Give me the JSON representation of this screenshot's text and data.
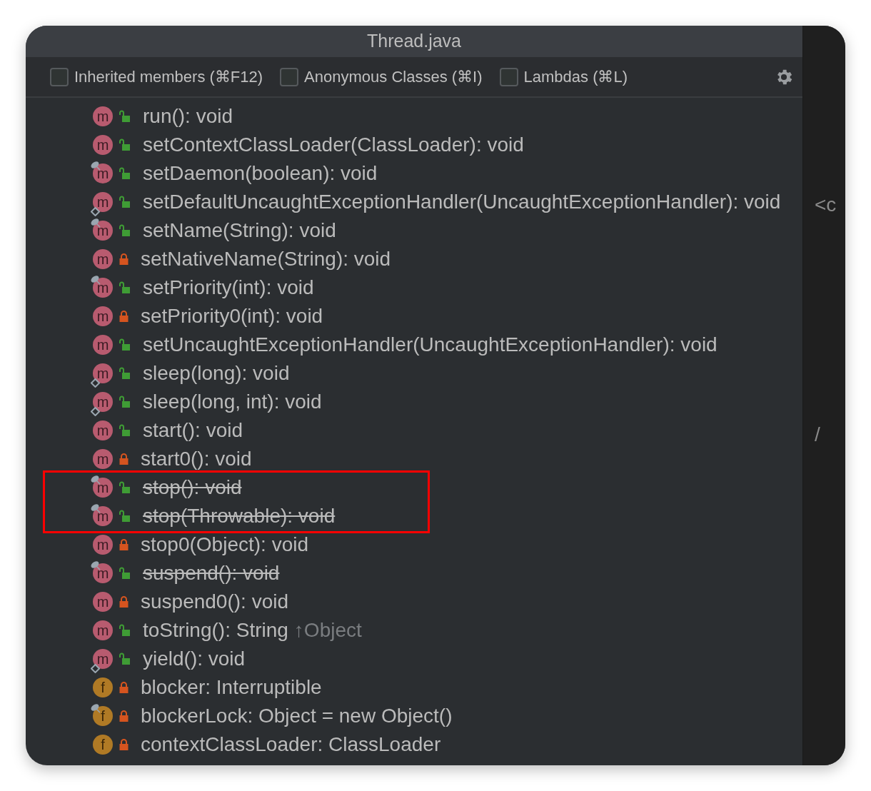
{
  "window": {
    "title": "Thread.java"
  },
  "filters": [
    {
      "label": "Inherited members (⌘F12)",
      "checked": false
    },
    {
      "label": "Anonymous Classes (⌘I)",
      "checked": false
    },
    {
      "label": "Lambdas (⌘L)",
      "checked": false
    }
  ],
  "members": [
    {
      "icon_letter": "m",
      "kind": "method",
      "locked": false,
      "pin_mark": false,
      "diamond_mark": false,
      "deprecated": false,
      "highlighted": false,
      "text": "run(): void"
    },
    {
      "icon_letter": "m",
      "kind": "method",
      "locked": false,
      "pin_mark": false,
      "diamond_mark": false,
      "deprecated": false,
      "highlighted": false,
      "text": "setContextClassLoader(ClassLoader): void"
    },
    {
      "icon_letter": "m",
      "kind": "method",
      "locked": false,
      "pin_mark": true,
      "diamond_mark": false,
      "deprecated": false,
      "highlighted": false,
      "text": "setDaemon(boolean): void"
    },
    {
      "icon_letter": "m",
      "kind": "method",
      "locked": false,
      "pin_mark": false,
      "diamond_mark": true,
      "deprecated": false,
      "highlighted": false,
      "text": "setDefaultUncaughtExceptionHandler(UncaughtExceptionHandler): void"
    },
    {
      "icon_letter": "m",
      "kind": "method",
      "locked": false,
      "pin_mark": true,
      "diamond_mark": false,
      "deprecated": false,
      "highlighted": false,
      "text": "setName(String): void"
    },
    {
      "icon_letter": "m",
      "kind": "method",
      "locked": true,
      "pin_mark": false,
      "diamond_mark": false,
      "deprecated": false,
      "highlighted": false,
      "text": "setNativeName(String): void"
    },
    {
      "icon_letter": "m",
      "kind": "method",
      "locked": false,
      "pin_mark": true,
      "diamond_mark": false,
      "deprecated": false,
      "highlighted": false,
      "text": "setPriority(int): void"
    },
    {
      "icon_letter": "m",
      "kind": "method",
      "locked": true,
      "pin_mark": false,
      "diamond_mark": false,
      "deprecated": false,
      "highlighted": false,
      "text": "setPriority0(int): void"
    },
    {
      "icon_letter": "m",
      "kind": "method",
      "locked": false,
      "pin_mark": false,
      "diamond_mark": false,
      "deprecated": false,
      "highlighted": false,
      "text": "setUncaughtExceptionHandler(UncaughtExceptionHandler): void"
    },
    {
      "icon_letter": "m",
      "kind": "method",
      "locked": false,
      "pin_mark": false,
      "diamond_mark": true,
      "deprecated": false,
      "highlighted": false,
      "text": "sleep(long): void"
    },
    {
      "icon_letter": "m",
      "kind": "method",
      "locked": false,
      "pin_mark": false,
      "diamond_mark": true,
      "deprecated": false,
      "highlighted": false,
      "text": "sleep(long, int): void"
    },
    {
      "icon_letter": "m",
      "kind": "method",
      "locked": false,
      "pin_mark": false,
      "diamond_mark": false,
      "deprecated": false,
      "highlighted": false,
      "text": "start(): void"
    },
    {
      "icon_letter": "m",
      "kind": "method",
      "locked": true,
      "pin_mark": false,
      "diamond_mark": false,
      "deprecated": false,
      "highlighted": false,
      "text": "start0(): void"
    },
    {
      "icon_letter": "m",
      "kind": "method",
      "locked": false,
      "pin_mark": true,
      "diamond_mark": false,
      "deprecated": true,
      "highlighted": true,
      "text": "stop(): void"
    },
    {
      "icon_letter": "m",
      "kind": "method",
      "locked": false,
      "pin_mark": true,
      "diamond_mark": false,
      "deprecated": true,
      "highlighted": true,
      "text": "stop(Throwable): void"
    },
    {
      "icon_letter": "m",
      "kind": "method",
      "locked": true,
      "pin_mark": false,
      "diamond_mark": false,
      "deprecated": false,
      "highlighted": false,
      "text": "stop0(Object): void"
    },
    {
      "icon_letter": "m",
      "kind": "method",
      "locked": false,
      "pin_mark": true,
      "diamond_mark": false,
      "deprecated": true,
      "highlighted": false,
      "text": "suspend(): void"
    },
    {
      "icon_letter": "m",
      "kind": "method",
      "locked": true,
      "pin_mark": false,
      "diamond_mark": false,
      "deprecated": false,
      "highlighted": false,
      "text": "suspend0(): void"
    },
    {
      "icon_letter": "m",
      "kind": "method",
      "locked": false,
      "pin_mark": false,
      "diamond_mark": false,
      "deprecated": false,
      "highlighted": false,
      "text": "toString(): String",
      "inherited_from": "↑Object"
    },
    {
      "icon_letter": "m",
      "kind": "method",
      "locked": false,
      "pin_mark": false,
      "diamond_mark": true,
      "deprecated": false,
      "highlighted": false,
      "text": "yield(): void"
    },
    {
      "icon_letter": "f",
      "kind": "field",
      "locked": true,
      "pin_mark": false,
      "diamond_mark": false,
      "deprecated": false,
      "highlighted": false,
      "text": "blocker: Interruptible"
    },
    {
      "icon_letter": "f",
      "kind": "field",
      "locked": true,
      "pin_mark": true,
      "diamond_mark": false,
      "deprecated": false,
      "highlighted": false,
      "text": "blockerLock: Object = new Object()"
    },
    {
      "icon_letter": "f",
      "kind": "field",
      "locked": true,
      "pin_mark": false,
      "diamond_mark": false,
      "deprecated": false,
      "highlighted": false,
      "text": "contextClassLoader: ClassLoader"
    }
  ],
  "editor": {
    "fragments": [
      "<c",
      "/"
    ]
  }
}
